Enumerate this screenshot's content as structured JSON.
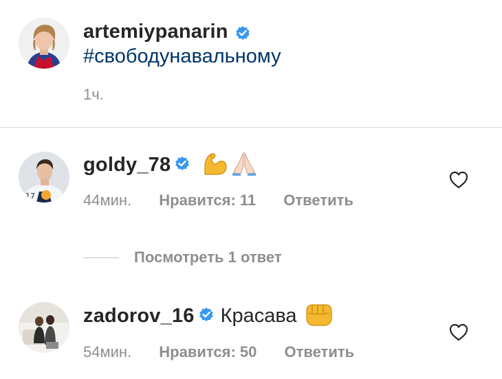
{
  "post": {
    "username": "artemiypanarin",
    "caption": "#свободунавальному",
    "time": "1ч."
  },
  "comments": [
    {
      "username": "goldy_78",
      "text": "",
      "emojis": [
        "flexed-biceps",
        "folded-hands"
      ],
      "time": "44мин.",
      "likes": "Нравится: 11",
      "reply": "Ответить"
    },
    {
      "username": "zadorov_16",
      "text": "Красава",
      "emojis": [
        "oncoming-fist"
      ],
      "time": "54мин.",
      "likes": "Нравится: 50",
      "reply": "Ответить"
    }
  ],
  "view_replies": "Посмотреть 1 ответ",
  "colors": {
    "verified": "#3897f0",
    "muted": "#8e8e8e",
    "hashtag": "#003569",
    "emoji": "#f5b82e"
  }
}
